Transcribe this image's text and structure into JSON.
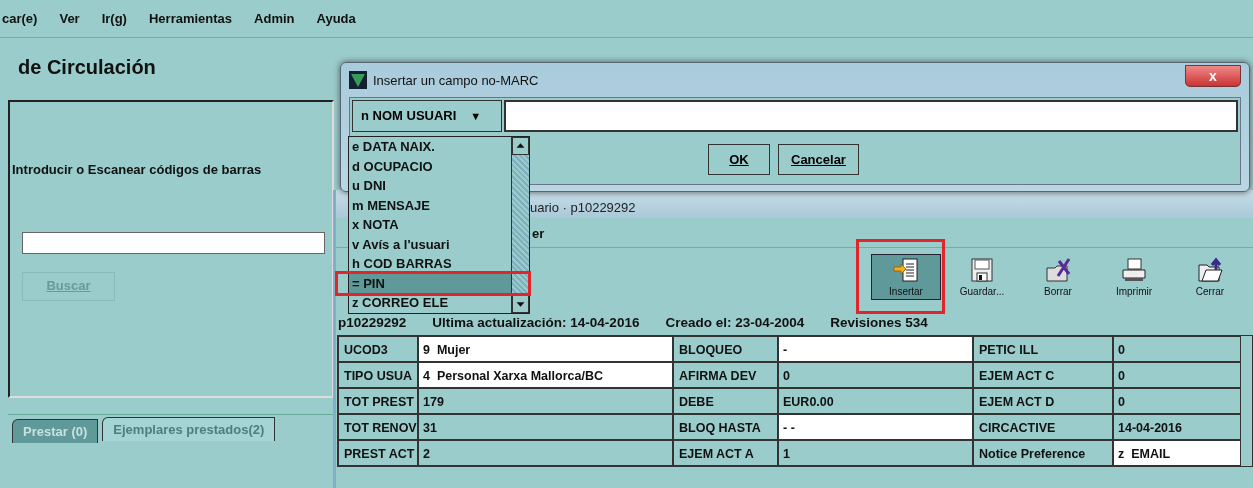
{
  "menu": [
    "car(e)",
    "Ver",
    "Ir(g)",
    "Herramientas",
    "Admin",
    "Ayuda"
  ],
  "app_title": "de Circulación",
  "barcode_panel": {
    "prompt": "Introducir o Escanear códigos de barras",
    "button": {
      "label": "Buscar",
      "disabled": true
    }
  },
  "tabs": [
    {
      "label": "Prestar (0)",
      "selected": false,
      "disabled": true
    },
    {
      "label": "Ejemplares prestados(2)",
      "selected": true,
      "disabled": false
    }
  ],
  "record_window": {
    "title": "uario · p10229292",
    "menu_text": "er",
    "toolbar": [
      {
        "label": "Insertar",
        "selected": true,
        "kind": "insert"
      },
      {
        "label": "Guardar...",
        "selected": false,
        "kind": "save"
      },
      {
        "label": "Borrar",
        "selected": false,
        "kind": "delete"
      },
      {
        "label": "Imprimir",
        "selected": false,
        "kind": "print"
      },
      {
        "label": "Cerrar",
        "selected": false,
        "kind": "close"
      }
    ],
    "info": [
      "p10229292",
      "Ultima actualización: 14-04-2016",
      "Creado el: 23-04-2004",
      "Revisiones 534"
    ],
    "fields": [
      [
        {
          "label": "UCOD3",
          "value": "9  Mujer",
          "editable": true
        },
        {
          "label": "BLOQUEO",
          "value": "-",
          "editable": true
        },
        {
          "label": "PETIC ILL",
          "value": "0",
          "editable": false
        }
      ],
      [
        {
          "label": "TIPO USUA",
          "value": "4  Personal Xarxa Mallorca/BC",
          "editable": true
        },
        {
          "label": "AFIRMA DEV",
          "value": "0",
          "editable": false
        },
        {
          "label": "EJEM ACT C",
          "value": "0",
          "editable": false
        }
      ],
      [
        {
          "label": "TOT PREST",
          "value": "179",
          "editable": false
        },
        {
          "label": "DEBE",
          "value": "EUR0.00",
          "editable": false
        },
        {
          "label": "EJEM ACT D",
          "value": "0",
          "editable": false
        }
      ],
      [
        {
          "label": "TOT RENOV",
          "value": "31",
          "editable": false
        },
        {
          "label": "BLOQ HASTA",
          "value": "- -",
          "editable": true
        },
        {
          "label": "CIRCACTIVE",
          "value": "14-04-2016",
          "editable": false
        }
      ],
      [
        {
          "label": "PREST ACT",
          "value": "2",
          "editable": false
        },
        {
          "label": "EJEM ACT A",
          "value": "1",
          "editable": false
        },
        {
          "label": "Notice Preference",
          "value": "z  EMAIL",
          "editable": true
        }
      ]
    ]
  },
  "dialog": {
    "title": "Insertar un campo no-MARC",
    "field_type": "n NOM USUARI",
    "dropdown_arrow": "▼",
    "options": [
      {
        "label": "e DATA NAIX.",
        "selected": false
      },
      {
        "label": "d OCUPACIO",
        "selected": false
      },
      {
        "label": "u DNI",
        "selected": false
      },
      {
        "label": "m MENSAJE",
        "selected": false
      },
      {
        "label": "x NOTA",
        "selected": false
      },
      {
        "label": "v Avís a l'usuari",
        "selected": false
      },
      {
        "label": "h COD BARRAS",
        "selected": false
      },
      {
        "label": "= PIN",
        "selected": true
      },
      {
        "label": "z CORREO ELE",
        "selected": false
      }
    ],
    "buttons": [
      "OK",
      "Cancelar"
    ],
    "close": "x"
  }
}
